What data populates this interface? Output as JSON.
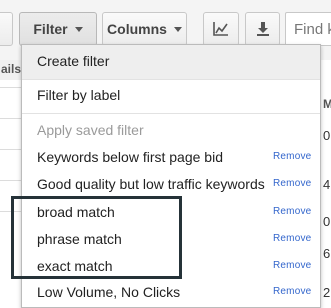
{
  "toolbar": {
    "filter_label": "Filter",
    "columns_label": "Columns",
    "search_placeholder": "Find k"
  },
  "table": {
    "header_partial": "ails",
    "right_header_partial": "M",
    "right_values": [
      "0(",
      "4(",
      "0(",
      "6(",
      "2("
    ]
  },
  "filter_menu": {
    "create_label": "Create filter",
    "by_label_label": "Filter by label",
    "apply_saved_header": "Apply saved filter",
    "saved_filters": [
      {
        "name": "Keywords below first page bid",
        "action": "Remove"
      },
      {
        "name": "Good quality but low traffic keywords",
        "action": "Remove"
      },
      {
        "name": "broad match",
        "action": "Remove"
      },
      {
        "name": "phrase match",
        "action": "Remove"
      },
      {
        "name": "exact match",
        "action": "Remove"
      },
      {
        "name": "Low Volume, No Clicks",
        "action": "Remove"
      }
    ]
  },
  "colors": {
    "link": "#3366cc",
    "highlight_frame": "#253238",
    "hover_row": "#eeeeee"
  },
  "icons": [
    "dropdown-caret-icon",
    "line-chart-icon",
    "download-icon"
  ]
}
